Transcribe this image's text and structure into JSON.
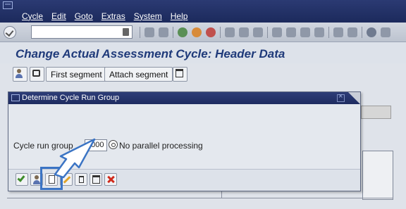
{
  "menubar": {
    "items": [
      "Cycle",
      "Edit",
      "Goto",
      "Extras",
      "System",
      "Help"
    ]
  },
  "page": {
    "title": "Change Actual Assessment Cycle: Header Data"
  },
  "app_toolbar": {
    "first_segment": "First segment",
    "attach_segment": "Attach segment"
  },
  "dialog": {
    "title": "Determine Cycle Run Group",
    "field_label": "Cycle run group",
    "field_value": "0000",
    "field_desc": "No parallel processing"
  },
  "colors": {
    "menubar": "#1c2a5c",
    "title_text": "#1f3a7a",
    "highlight": "#3b74c4",
    "arrow_fill": "#ffffff",
    "arrow_stroke": "#3b74c4"
  }
}
